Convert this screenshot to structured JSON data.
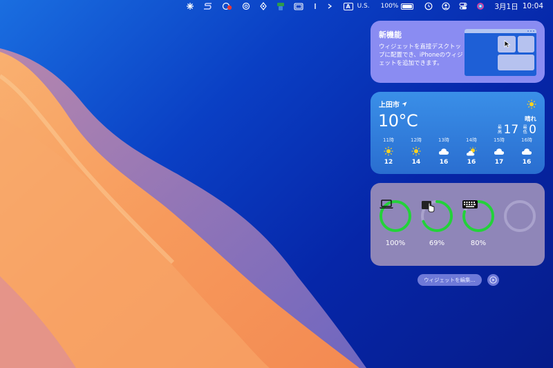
{
  "menubar": {
    "icons": [
      "fan-icon",
      "s-icon",
      "record-icon",
      "chatgpt-icon",
      "pen-icon",
      "color-picker-icon",
      "window-icon",
      "cursor-icon",
      "chevron-icon"
    ],
    "input_badge": "A",
    "input_source": "U.S.",
    "battery_pct": "100%",
    "date": "3月1日",
    "time": "10:04"
  },
  "new_features": {
    "title": "新機能",
    "description": "ウィジェットを直接デスクトップに配置でき、iPhoneのウィジェットを追加できます。"
  },
  "weather": {
    "city": "上田市",
    "temp": "10°C",
    "condition": "晴れ",
    "high_label": "最高",
    "high": "17",
    "low_label": "最低",
    "low": "0",
    "hours": [
      {
        "time": "11時",
        "icon": "sun",
        "temp": "12"
      },
      {
        "time": "12時",
        "icon": "sun",
        "temp": "14"
      },
      {
        "time": "13時",
        "icon": "cloud",
        "temp": "16"
      },
      {
        "time": "14時",
        "icon": "partly-cloudy",
        "temp": "16"
      },
      {
        "time": "15時",
        "icon": "cloud",
        "temp": "17"
      },
      {
        "time": "16時",
        "icon": "cloud",
        "temp": "16"
      }
    ]
  },
  "batteries": {
    "items": [
      {
        "device": "laptop",
        "percent": "100%",
        "level": 1.0
      },
      {
        "device": "trackpad",
        "percent": "69%",
        "level": 0.69
      },
      {
        "device": "keyboard",
        "percent": "80%",
        "level": 0.8
      },
      {
        "device": "empty",
        "percent": "",
        "level": 0
      }
    ],
    "ring_color": "#23d13a"
  },
  "edit": {
    "label": "ウィジェットを編集..."
  }
}
